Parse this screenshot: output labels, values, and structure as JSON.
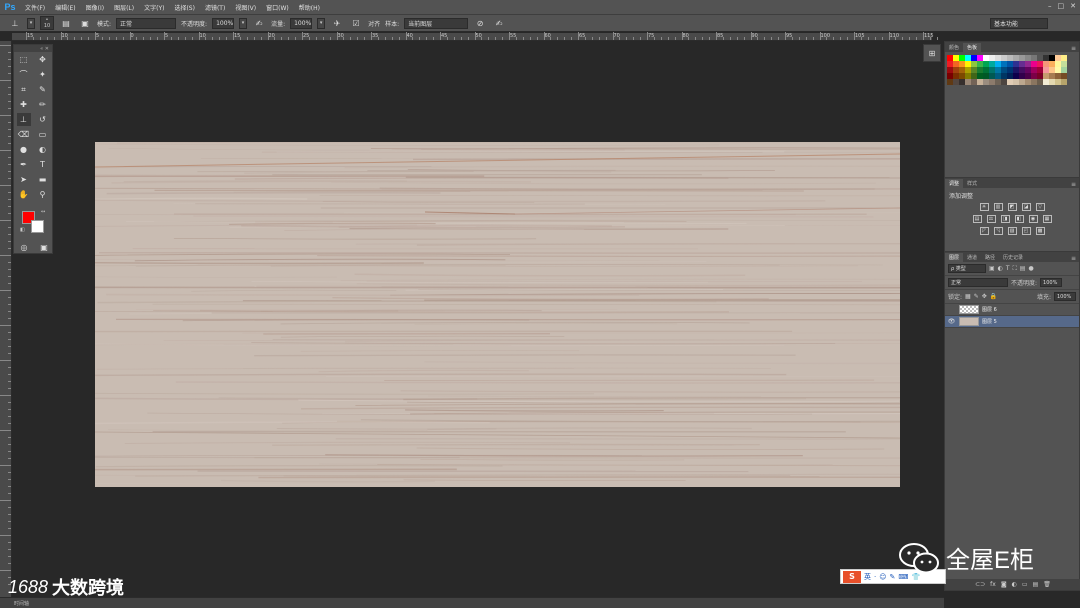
{
  "app": {
    "logo": "Ps"
  },
  "menu": [
    "文件(F)",
    "编辑(E)",
    "图像(I)",
    "图层(L)",
    "文字(Y)",
    "选择(S)",
    "滤镜(T)",
    "视图(V)",
    "窗口(W)",
    "帮助(H)"
  ],
  "window_controls": [
    "–",
    "□",
    "✕"
  ],
  "options_bar": {
    "brush_size": "10",
    "mode_label": "模式:",
    "mode_value": "正常",
    "opacity_label": "不透明度:",
    "opacity_value": "100%",
    "flow_label": "流量:",
    "flow_value": "100%",
    "aligned_label": "对齐",
    "sample_label": "样本:",
    "sample_value": "当前图层",
    "workspace": "基本功能"
  },
  "ruler_labels": [
    "15",
    "10",
    "5",
    "0",
    "5",
    "10",
    "15",
    "20",
    "25",
    "30",
    "35",
    "40",
    "45",
    "50",
    "55",
    "60",
    "65",
    "70",
    "75",
    "80",
    "85",
    "90",
    "95",
    "100",
    "105",
    "110",
    "115"
  ],
  "tools": {
    "marquee": "⬚",
    "move": "✥",
    "lasso": "⌒",
    "magic": "✦",
    "crop": "⌗",
    "eyedropper": "✎",
    "heal": "✚",
    "brush": "✏",
    "stamp": "⊥",
    "history": "↺",
    "eraser": "⌫",
    "gradient": "▭",
    "blur": "●",
    "dodge": "◐",
    "pen": "✒",
    "type": "T",
    "path": "➤",
    "shape": "▬",
    "hand": "✋",
    "zoom": "⚲",
    "mask": "◎",
    "screen": "▣",
    "fg_color": "#ff0000",
    "bg_color": "#ffffff"
  },
  "swatches_panel": {
    "tabs": [
      "颜色",
      "色板"
    ],
    "active": 1
  },
  "adjustments_panel": {
    "tabs": [
      "调整",
      "样式"
    ],
    "title": "添加调整",
    "rows": [
      [
        "☀",
        "▥",
        "◩",
        "◪",
        "▽"
      ],
      [
        "▤",
        "⚖",
        "◨",
        "◧",
        "◉",
        "▦"
      ],
      [
        "◸",
        "◹",
        "▨",
        "◰",
        "▩"
      ]
    ]
  },
  "layers_panel": {
    "tabs": [
      "图层",
      "通道",
      "路径",
      "历史记录"
    ],
    "filter_label": "ρ 类型",
    "blend_mode": "正常",
    "opacity_label": "不透明度:",
    "opacity_value": "100%",
    "lock_label": "锁定:",
    "fill_label": "填充:",
    "fill_value": "100%",
    "layers": [
      {
        "name": "图层 6",
        "visible": false,
        "selected": false
      },
      {
        "name": "图层 5",
        "visible": true,
        "selected": true
      }
    ],
    "footer_icons": [
      "⊂⊃",
      "fx",
      "◙",
      "◐",
      "▭",
      "▤",
      "🗑"
    ]
  },
  "status_bar": {
    "text": "时间轴"
  },
  "ime": {
    "logo": "S",
    "lang": "英",
    "icons": [
      "·",
      "☺",
      "✎",
      "⌨",
      "👕"
    ]
  },
  "watermark_right": "全屋E柜",
  "watermark_left": {
    "logo": "1688",
    "text": "大数跨境"
  }
}
